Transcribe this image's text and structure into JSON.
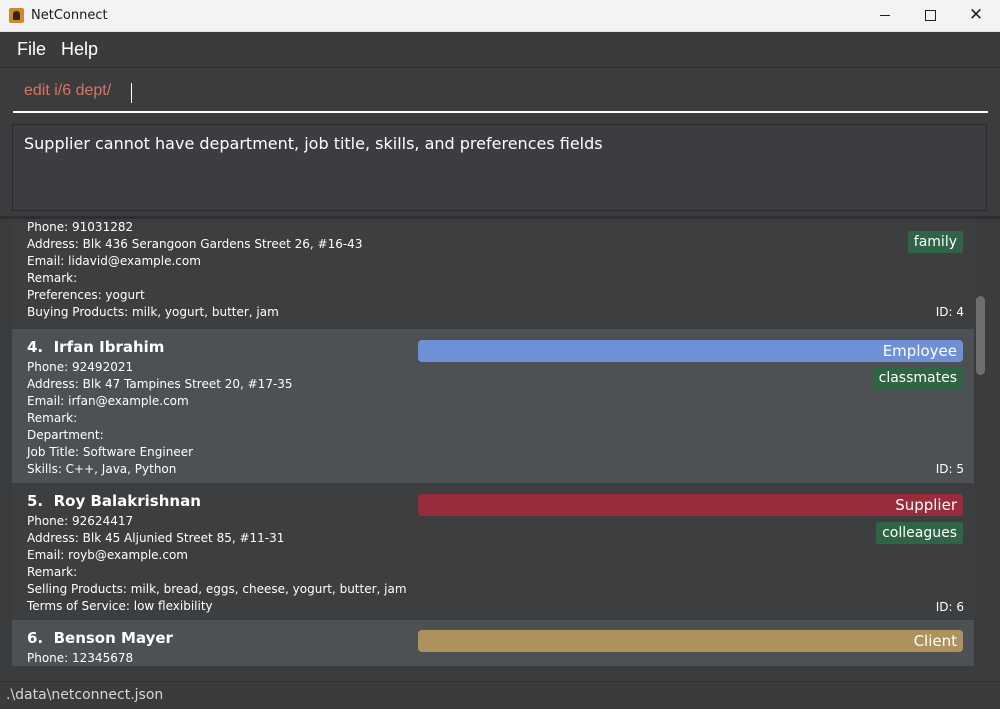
{
  "window": {
    "title": "NetConnect",
    "minimize_icon": "minimize-icon",
    "maximize_icon": "maximize-icon",
    "close_icon": "close-icon"
  },
  "menu": {
    "file": "File",
    "help": "Help"
  },
  "command": {
    "value": "edit i/6 dept/"
  },
  "result": {
    "message": "Supplier cannot have department, job title, skills, and preferences fields"
  },
  "colors": {
    "employee": "#6f8fd6",
    "supplier": "#9a2b3a",
    "client": "#ad925e",
    "tag": "#2f6444",
    "command_text": "#d9735f"
  },
  "cards": [
    {
      "fields": [
        "Phone: 91031282",
        "Address: Blk 436 Serangoon Gardens Street 26, #16-43",
        "Email: lidavid@example.com",
        "Remark:",
        "Preferences: yogurt",
        "Buying Products: milk, yogurt, butter, jam"
      ],
      "tags": [
        "family"
      ],
      "id": "ID: 4"
    },
    {
      "index": "4.",
      "name": "Irfan Ibrahim",
      "role": "Employee",
      "fields": [
        "Phone: 92492021",
        "Address: Blk 47 Tampines Street 20, #17-35",
        "Email: irfan@example.com",
        "Remark:",
        "Department:",
        "Job Title: Software Engineer",
        "Skills: C++, Java, Python"
      ],
      "tags": [
        "classmates"
      ],
      "id": "ID: 5"
    },
    {
      "index": "5.",
      "name": "Roy Balakrishnan",
      "role": "Supplier",
      "fields": [
        "Phone: 92624417",
        "Address: Blk 45 Aljunied Street 85, #11-31",
        "Email: royb@example.com",
        "Remark:",
        "Selling Products: milk, bread, eggs, cheese, yogurt, butter, jam",
        "Terms of Service: low flexibility"
      ],
      "tags": [
        "colleagues"
      ],
      "id": "ID: 6"
    },
    {
      "index": "6.",
      "name": "Benson Mayer",
      "role": "Client",
      "fields": [
        "Phone: 12345678"
      ]
    }
  ],
  "status": {
    "path": ".\\data\\netconnect.json"
  }
}
